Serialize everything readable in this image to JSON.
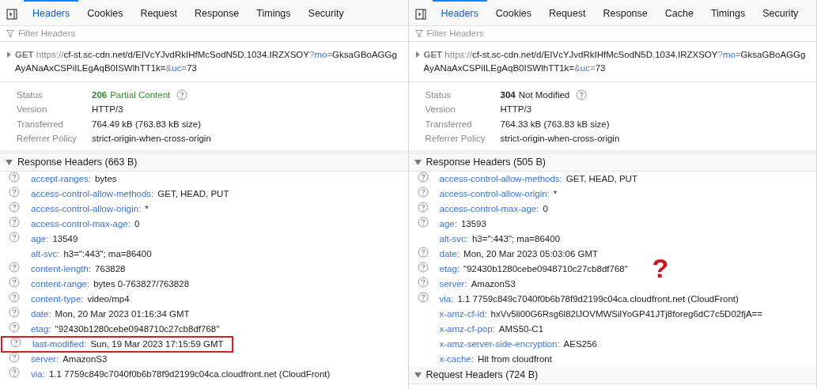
{
  "panels": [
    {
      "tabs": [
        {
          "label": "Headers",
          "selected": true
        },
        {
          "label": "Cookies",
          "selected": false
        },
        {
          "label": "Request",
          "selected": false
        },
        {
          "label": "Response",
          "selected": false
        },
        {
          "label": "Timings",
          "selected": false
        },
        {
          "label": "Security",
          "selected": false
        }
      ],
      "filter": {
        "placeholder": "Filter Headers"
      },
      "request": {
        "method": "GET",
        "url_parts": [
          {
            "kind": "scheme",
            "text": "https://"
          },
          {
            "kind": "path",
            "text": "cf-st.sc-cdn.net/d/EIVcYJvdRkIHfMcSodN5D.1034.IRZXSOY"
          },
          {
            "kind": "sep",
            "text": "?"
          },
          {
            "kind": "key",
            "text": "mo"
          },
          {
            "kind": "sep",
            "text": "="
          },
          {
            "kind": "path",
            "text": "GksaGBoAGGgAyANaAxCSPiILEgAqB0ISWlhTT1k="
          },
          {
            "kind": "sep",
            "text": "&"
          },
          {
            "kind": "key",
            "text": "uc"
          },
          {
            "kind": "sep",
            "text": "="
          },
          {
            "kind": "path",
            "text": "73"
          }
        ]
      },
      "summary": [
        {
          "label": "Status",
          "code": "206",
          "value": "Partial Content",
          "color": "#2e8a2e"
        },
        {
          "label": "Version",
          "value": "HTTP/3"
        },
        {
          "label": "Transferred",
          "value": "764.49 kB (763.83 kB size)"
        },
        {
          "label": "Referrer Policy",
          "value": "strict-origin-when-cross-origin"
        }
      ],
      "sections": [
        {
          "title": "Response Headers (663 B)",
          "expanded": true,
          "headers": [
            {
              "name": "accept-ranges:",
              "value": "bytes",
              "help": true,
              "highlighted": false
            },
            {
              "name": "access-control-allow-methods:",
              "value": "GET, HEAD, PUT",
              "help": true,
              "highlighted": false
            },
            {
              "name": "access-control-allow-origin:",
              "value": "*",
              "help": true,
              "highlighted": false
            },
            {
              "name": "access-control-max-age:",
              "value": "0",
              "help": true,
              "highlighted": false
            },
            {
              "name": "age:",
              "value": "13549",
              "help": true,
              "highlighted": false
            },
            {
              "name": "alt-svc:",
              "value": "h3=\":443\"; ma=86400",
              "help": false,
              "highlighted": false
            },
            {
              "name": "content-length:",
              "value": "763828",
              "help": true,
              "highlighted": false
            },
            {
              "name": "content-range:",
              "value": "bytes 0-763827/763828",
              "help": true,
              "highlighted": false
            },
            {
              "name": "content-type:",
              "value": "video/mp4",
              "help": true,
              "highlighted": false
            },
            {
              "name": "date:",
              "value": "Mon, 20 Mar 2023 01:16:34 GMT",
              "help": true,
              "highlighted": false
            },
            {
              "name": "etag:",
              "value": "\"92430b1280cebe0948710c27cb8df768\"",
              "help": true,
              "highlighted": false
            },
            {
              "name": "last-modified:",
              "value": "Sun, 19 Mar 2023 17:15:59 GMT",
              "help": true,
              "highlighted": true
            },
            {
              "name": "server:",
              "value": "AmazonS3",
              "help": true,
              "highlighted": false
            },
            {
              "name": "via:",
              "value": "1.1 7759c849c7040f0b6b78f9d2199c04ca.cloudfront.net (CloudFront)",
              "help": true,
              "highlighted": false
            }
          ]
        }
      ]
    },
    {
      "tabs": [
        {
          "label": "Headers",
          "selected": true
        },
        {
          "label": "Cookies",
          "selected": false
        },
        {
          "label": "Request",
          "selected": false
        },
        {
          "label": "Response",
          "selected": false
        },
        {
          "label": "Cache",
          "selected": false
        },
        {
          "label": "Timings",
          "selected": false
        },
        {
          "label": "Security",
          "selected": false
        }
      ],
      "filter": {
        "placeholder": "Filter Headers"
      },
      "request": {
        "method": "GET",
        "url_parts": [
          {
            "kind": "scheme",
            "text": "https://"
          },
          {
            "kind": "path",
            "text": "cf-st.sc-cdn.net/d/EIVcYJvdRkIHfMcSodN5D.1034.IRZXSOY"
          },
          {
            "kind": "sep",
            "text": "?"
          },
          {
            "kind": "key",
            "text": "mo"
          },
          {
            "kind": "sep",
            "text": "="
          },
          {
            "kind": "path",
            "text": "GksaGBoAGGgAyANaAxCSPiILEgAqB0ISWlhTT1k="
          },
          {
            "kind": "sep",
            "text": "&"
          },
          {
            "kind": "key",
            "text": "uc"
          },
          {
            "kind": "sep",
            "text": "="
          },
          {
            "kind": "path",
            "text": "73"
          }
        ]
      },
      "summary": [
        {
          "label": "Status",
          "code": "304",
          "value": "Not Modified",
          "color": "#222222"
        },
        {
          "label": "Version",
          "value": "HTTP/3"
        },
        {
          "label": "Transferred",
          "value": "764.33 kB (763.83 kB size)"
        },
        {
          "label": "Referrer Policy",
          "value": "strict-origin-when-cross-origin"
        }
      ],
      "annotation": "?",
      "sections": [
        {
          "title": "Response Headers (505 B)",
          "expanded": true,
          "headers": [
            {
              "name": "access-control-allow-methods:",
              "value": "GET, HEAD, PUT",
              "help": true,
              "highlighted": false
            },
            {
              "name": "access-control-allow-origin:",
              "value": "*",
              "help": true,
              "highlighted": false
            },
            {
              "name": "access-control-max-age:",
              "value": "0",
              "help": true,
              "highlighted": false
            },
            {
              "name": "age:",
              "value": "13593",
              "help": true,
              "highlighted": false
            },
            {
              "name": "alt-svc:",
              "value": "h3=\":443\"; ma=86400",
              "help": false,
              "highlighted": false
            },
            {
              "name": "date:",
              "value": "Mon, 20 Mar 2023 05:03:06 GMT",
              "help": true,
              "highlighted": false
            },
            {
              "name": "etag:",
              "value": "\"92430b1280cebe0948710c27cb8df768\"",
              "help": true,
              "highlighted": false
            },
            {
              "name": "server:",
              "value": "AmazonS3",
              "help": true,
              "highlighted": false
            },
            {
              "name": "via:",
              "value": "1.1 7759c849c7040f0b6b78f9d2199c04ca.cloudfront.net (CloudFront)",
              "help": true,
              "highlighted": false
            },
            {
              "name": "x-amz-cf-id:",
              "value": "hxVv5li00G6Rsg6l82lJOVMWSilYoGP41JTj8foreg6dC7c5D02fjA==",
              "help": false,
              "highlighted": false
            },
            {
              "name": "x-amz-cf-pop:",
              "value": "AMS50-C1",
              "help": false,
              "highlighted": false
            },
            {
              "name": "x-amz-server-side-encryption:",
              "value": "AES256",
              "help": false,
              "highlighted": false
            },
            {
              "name": "x-cache:",
              "value": "Hit from cloudfront",
              "help": false,
              "highlighted": false
            }
          ]
        },
        {
          "title": "Request Headers (724 B)",
          "expanded": true
        }
      ]
    }
  ]
}
